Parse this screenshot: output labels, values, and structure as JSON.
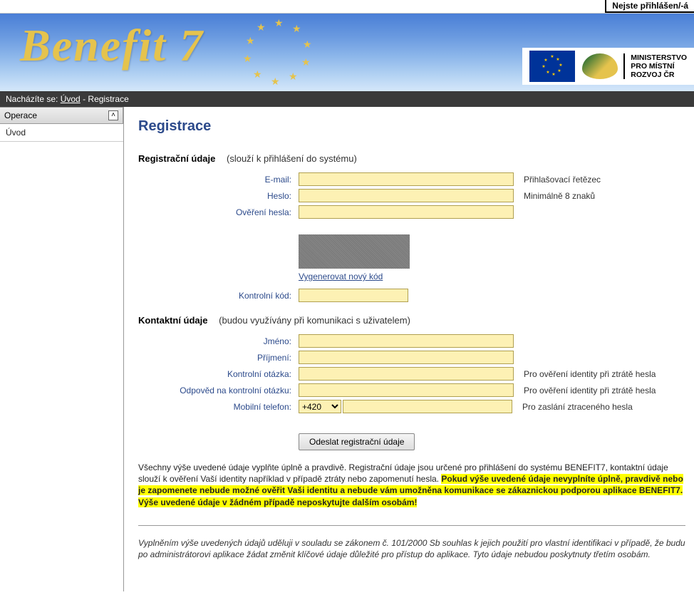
{
  "topbar": {
    "login_status": "Nejste přihlášen/-á"
  },
  "header": {
    "logo": "Benefit 7",
    "mmr_line1": "MINISTERSTVO",
    "mmr_line2": "PRO MÍSTNÍ",
    "mmr_line3": "ROZVOJ ČR"
  },
  "breadcrumb": {
    "prefix": "Nacházíte se:",
    "link": "Úvod",
    "tail": " - Registrace"
  },
  "sidebar": {
    "header": "Operace",
    "items": [
      "Úvod"
    ]
  },
  "page": {
    "title": "Registrace",
    "section1_title": "Registrační údaje",
    "section1_sub": "(slouží k přihlášení do systému)",
    "email_label": "E-mail:",
    "email_hint": "Přihlašovací řetězec",
    "heslo_label": "Heslo:",
    "heslo_hint": "Minimálně 8 znaků",
    "overeni_label": "Ověření hesla:",
    "captcha_link": "Vygenerovat nový kód",
    "kontrolni_kod_label": "Kontrolní kód:",
    "section2_title": "Kontaktní údaje",
    "section2_sub": "(budou využívány při komunikaci s uživatelem)",
    "jmeno_label": "Jméno:",
    "prijmeni_label": "Příjmení:",
    "kontrolni_otazka_label": "Kontrolní otázka:",
    "kontrolni_otazka_hint": "Pro ověření identity při ztrátě hesla",
    "odpoved_label": "Odpověd na kontrolní otázku:",
    "odpoved_hint": "Pro ověření identity při ztrátě hesla",
    "telefon_label": "Mobilní telefon:",
    "telefon_prefix": "+420",
    "telefon_hint": "Pro zaslání ztraceného hesla",
    "submit": "Odeslat registrační údaje",
    "info_part1": "Všechny výše uvedené údaje vyplňte úplně a pravdivě. Registrační údaje jsou určené pro přihlášení do systému BENEFIT7, kontaktní údaje slouží k ověření Vaší identity například v případě ztráty nebo zapomenutí hesla. ",
    "info_highlight": "Pokud výše uvedené údaje nevyplníte úplně, pravdivě nebo je zapomenete nebude možné ověřit Vaši identitu a nebude vám umožněna komunikace se zákaznickou podporou aplikace BENEFIT7. Výše uvedené údaje v žádném případě neposkytujte dalším osobám!",
    "legal_note": "Vyplněním výše uvedených údajů uděluji v souladu se zákonem č. 101/2000 Sb souhlas k jejich použití pro vlastní identifikaci v případě, že budu po administrátorovi aplikace žádat změnit klíčové údaje důležité pro přístup do aplikace. Tyto údaje nebudou poskytnuty třetím osobám."
  }
}
